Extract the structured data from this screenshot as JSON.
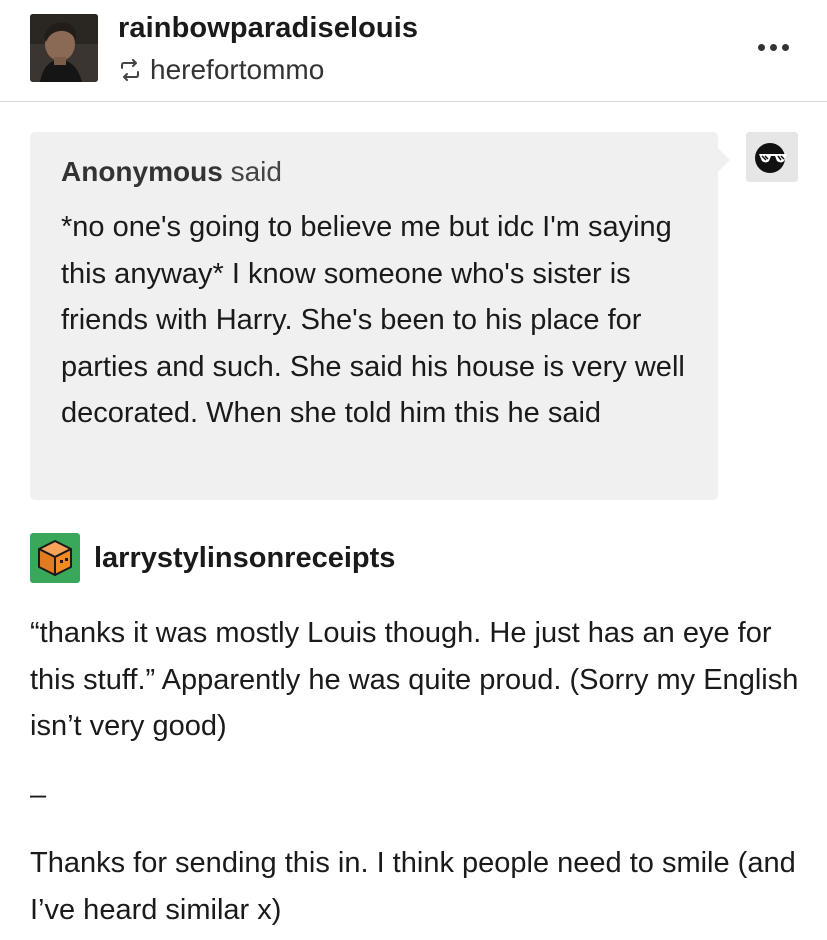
{
  "post": {
    "username": "rainbowparadiselouis",
    "reblogged_from": "herefortommo",
    "more_icon": "more-horizontal-icon"
  },
  "ask": {
    "asker": "Anonymous",
    "said": "said",
    "question": "*no one's going to believe me but idc I'm saying this anyway* I know someone who's sister is friends with Harry. She's been to his place for parties and such. She said his house is very well decorated. When she told him this he said",
    "avatar_icon": "sunglasses-icon"
  },
  "answer": {
    "answerer": "larrystylinsonreceipts",
    "avatar_icon": "cube-avatar-icon",
    "paragraphs": [
      "“thanks it was mostly Louis though. He just has an eye for this stuff.” Apparently he was quite proud. (Sorry my English isn’t very good)",
      "–",
      "Thanks for sending this in. I think people need to smile (and I’ve heard similar x)"
    ]
  },
  "colors": {
    "ask_background": "#f0f0f0",
    "answer_avatar_green": "#3aa85b",
    "answer_avatar_orange": "#f08a24",
    "divider": "#d9d9d9"
  }
}
